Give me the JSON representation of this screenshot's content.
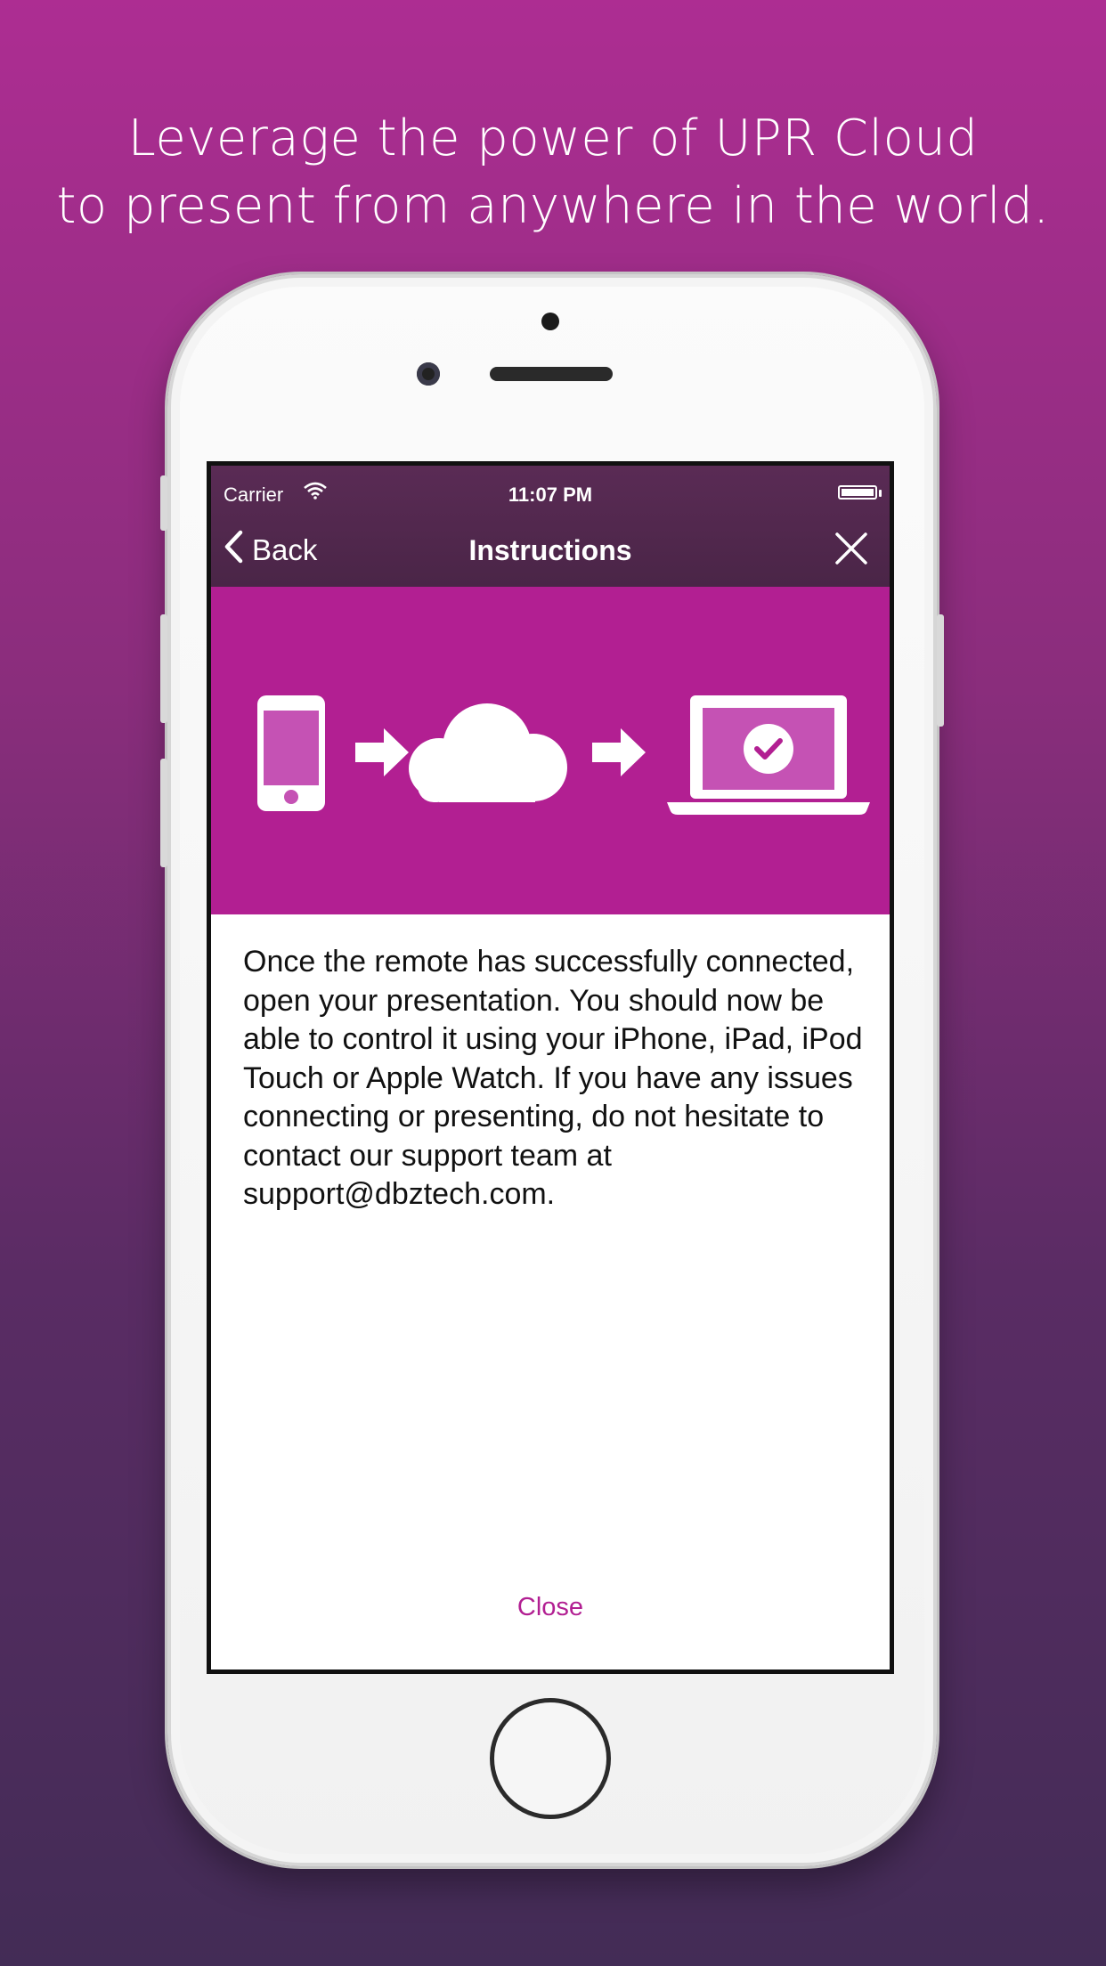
{
  "headline": {
    "line1": "Leverage the power of UPR Cloud",
    "line2": "to present from anywhere in the world."
  },
  "status_bar": {
    "carrier": "Carrier",
    "time": "11:07 PM",
    "wifi_icon": "wifi-icon",
    "battery_icon": "battery-icon"
  },
  "nav": {
    "back_label": "Back",
    "title": "Instructions",
    "close_icon": "close-icon"
  },
  "banner": {
    "color": "#b21f92",
    "icons": [
      "phone-icon",
      "arrow-right-icon",
      "cloud-icon",
      "arrow-right-icon",
      "laptop-check-icon"
    ]
  },
  "body": {
    "text": "Once the remote has successfully connected, open your presentation. You should now be able to control it using your iPhone, iPad, iPod Touch or Apple Watch. If you have any issues connecting or presenting, do not hesitate to contact our support team at support@dbztech.com."
  },
  "footer": {
    "close_label": "Close"
  },
  "colors": {
    "accent": "#b21f92",
    "navbar": "#4f2649"
  }
}
